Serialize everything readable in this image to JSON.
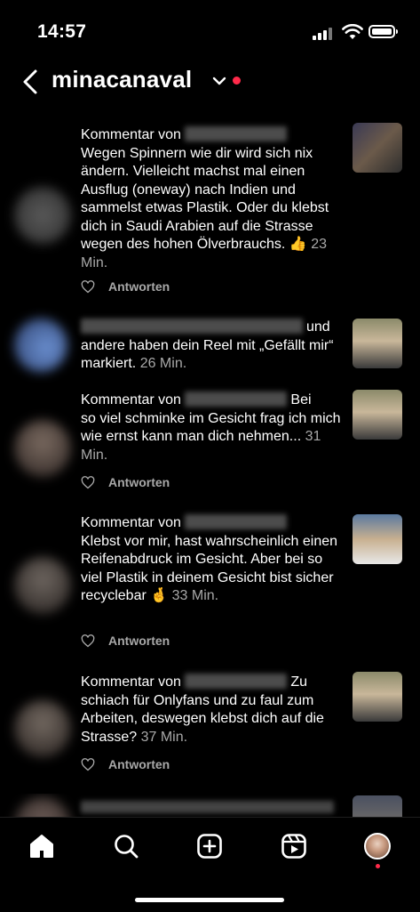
{
  "status_bar": {
    "time": "14:57"
  },
  "header": {
    "account": "minacanaval"
  },
  "notifications": [
    {
      "prefix": "Kommentar von",
      "body": "Wegen Spinnern wie dir wird sich nix ändern. Vielleicht machst mal einen Ausflug (oneway) nach Indien und sammelst etwas Plastik. Oder du klebst dich in Saudi Arabien auf die Strasse wegen des hohen Ölverbrauchs. 👍",
      "time": "23 Min.",
      "reply": "Antworten"
    },
    {
      "body": "andere haben dein Reel mit „Gefällt mir“ markiert.",
      "after_name": "und",
      "time": "26 Min."
    },
    {
      "prefix": "Kommentar von",
      "after_name": "Bei",
      "body": "so viel schminke im Gesicht frag ich mich wie ernst kann man dich nehmen...",
      "time": "31 Min.",
      "reply": "Antworten"
    },
    {
      "prefix": "Kommentar von",
      "body": "Klebst vor mir, hast wahrscheinlich einen Reifenabdruck im Gesicht. Aber bei so viel Plastik in deinem Gesicht bist sicher recyclebar 🤞",
      "time": "33 Min.",
      "reply": "Antworten"
    },
    {
      "prefix": "Kommentar von",
      "after_name": "Zu",
      "body": "schiach für Onlyfans und zu faul zum Arbeiten, deswegen klebst dich auf die Strasse?",
      "time": "37 Min.",
      "reply": "Antworten"
    }
  ],
  "tab_bar": {
    "items": [
      "home-icon",
      "search-icon",
      "create-icon",
      "reels-icon",
      "profile-avatar"
    ]
  }
}
